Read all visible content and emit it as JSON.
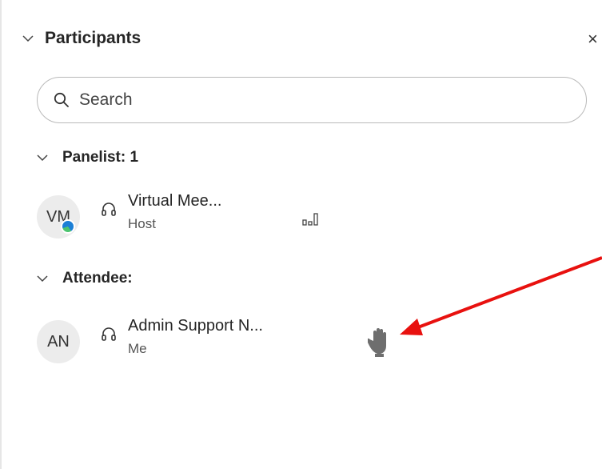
{
  "panel": {
    "title": "Participants",
    "close_glyph": "×"
  },
  "search": {
    "placeholder": "Search"
  },
  "sections": {
    "panelist": {
      "label": "Panelist: 1"
    },
    "attendee": {
      "label": "Attendee:"
    }
  },
  "participants": [
    {
      "initials": "VM",
      "name": "Virtual Mee...",
      "role": "Host",
      "status": "audio-level-icon"
    },
    {
      "initials": "AN",
      "name": "Admin Support N...",
      "role": "Me",
      "status": "raised-hand-icon"
    }
  ],
  "colors": {
    "annotation_arrow": "#e8110f",
    "raised_hand": "#6e6e6e",
    "avatar_bg": "#ececec"
  }
}
